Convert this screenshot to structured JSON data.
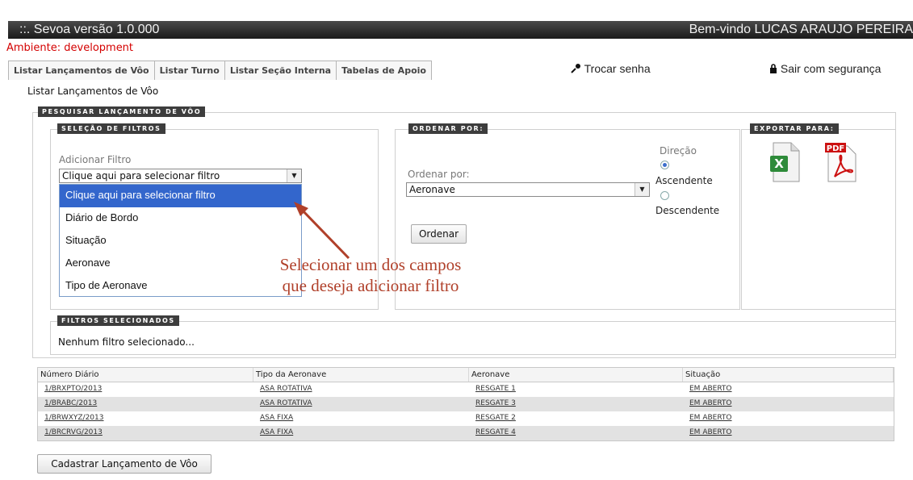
{
  "header": {
    "app_title": "::.  Sevoa versão 1.0.000",
    "welcome": "Bem-vindo LUCAS ARAUJO PEREIRA"
  },
  "environment": "Ambiente: development",
  "menu": {
    "tabs": [
      {
        "label": "Listar Lançamentos de Vôo"
      },
      {
        "label": "Listar Turno"
      },
      {
        "label": "Listar Seção Interna"
      },
      {
        "label": "Tabelas de Apoio"
      }
    ],
    "change_password": "Trocar senha",
    "logout": "Sair com segurança"
  },
  "page_title": "Listar Lançamentos de Vôo",
  "search": {
    "legend": "PESQUISAR LANÇAMENTO DE VÔO",
    "filters": {
      "legend": "SELEÇÃO DE FILTROS",
      "add_label": "Adicionar Filtro",
      "selected_value": "Clique aqui para selecionar filtro",
      "options": [
        "Clique aqui para selecionar filtro",
        "Diário de Bordo",
        "Situação",
        "Aeronave",
        "Tipo de Aeronave"
      ]
    },
    "order": {
      "legend": "ORDENAR POR:",
      "label": "Ordenar por:",
      "selected_value": "Aeronave",
      "direction_label": "Direção",
      "asc_label": "Ascendente",
      "desc_label": "Descendente",
      "direction_selected": "Ascendente",
      "button": "Ordenar"
    },
    "export": {
      "legend": "EXPORTAR PARA:",
      "pdf_badge": "PDF"
    },
    "selected_filters": {
      "legend": "FILTROS SELECIONADOS",
      "empty_text": "Nenhum filtro selecionado..."
    }
  },
  "annotation": {
    "line1": "Selecionar um dos campos",
    "line2": "que deseja adicionar filtro",
    "color": "#b0402a"
  },
  "table": {
    "columns": [
      "Número Diário",
      "Tipo da Aeronave",
      "Aeronave",
      "Situação"
    ],
    "rows": [
      [
        "1/BRXPTO/2013",
        "ASA ROTATIVA",
        "RESGATE 1",
        "EM ABERTO"
      ],
      [
        "1/BRABC/2013",
        "ASA ROTATIVA",
        "RESGATE 3",
        "EM ABERTO"
      ],
      [
        "1/BRWXYZ/2013",
        "ASA FIXA",
        "RESGATE 2",
        "EM ABERTO"
      ],
      [
        "1/BRCRVG/2013",
        "ASA FIXA",
        "RESGATE 4",
        "EM ABERTO"
      ]
    ]
  },
  "create_button": "Cadastrar Lançamento de Vôo",
  "colors": {
    "env_text": "#d40000",
    "dropdown_highlight": "#3366cc",
    "legend_bg": "#3d3d3d"
  }
}
